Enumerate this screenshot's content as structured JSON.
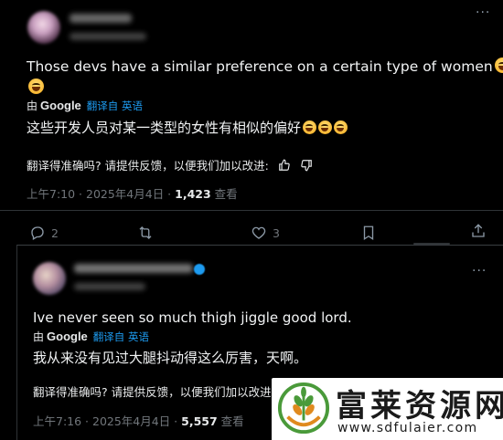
{
  "tweet1": {
    "display_name_blurred": "",
    "text_en": "Those devs have a similar preference on a certain type of women",
    "translated_prefix": "由",
    "translated_brand": "Google",
    "translated_suffix": "翻译自 英语",
    "text_zh": "这些开发人员对某一类型的女性有相似的偏好",
    "feedback": "翻译得准确吗? 请提供反馈，以便我们加以改进:",
    "time": "上午7:10 · 2025年4月4日 · ",
    "views": "1,423",
    "views_label": " 查看",
    "replies": "2",
    "likes": "3"
  },
  "tweet2": {
    "text_en": "Ive never seen so much thigh jiggle good lord.",
    "translated_prefix": "由",
    "translated_brand": "Google",
    "translated_suffix": "翻译自 英语",
    "text_zh": "我从来没有见过大腿抖动得这么厉害，天啊。",
    "feedback": "翻译得准确吗? 请提供反馈，以便我们加以改进:",
    "time": "上午7:16 · 2025年4月4日 · ",
    "views": "5,557",
    "views_label": " 查看"
  },
  "watermark": {
    "title": "富莱资源网",
    "url": "www.sdfulaier.com"
  },
  "icons": {
    "reply": "reply-icon",
    "retweet": "retweet-icon",
    "like": "heart-icon",
    "bookmark": "bookmark-icon",
    "share": "share-icon",
    "more": "more-icon",
    "thumbs_up": "thumbs-up-icon",
    "thumbs_down": "thumbs-down-icon"
  },
  "colors": {
    "background": "#000000",
    "text": "#e7e9ea",
    "muted": "#71767b",
    "link": "#1d9bf0",
    "divider": "#2f3336"
  }
}
